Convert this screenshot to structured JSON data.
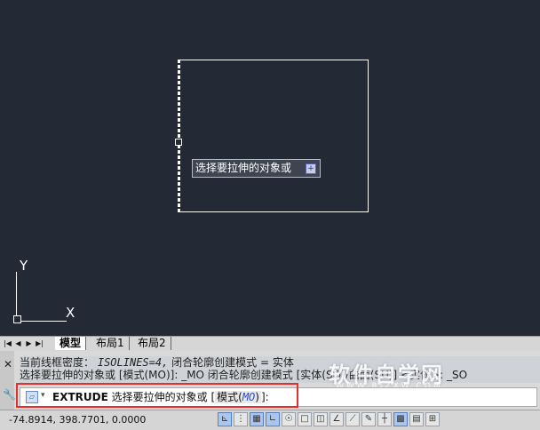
{
  "tooltip": {
    "text": "选择要拉伸的对象或",
    "expand_icon": "plus-box-icon",
    "expand_glyph": "+"
  },
  "ucs": {
    "y_label": "Y",
    "x_label": "X"
  },
  "layout_tabs": {
    "nav_glyphs": [
      "|◀",
      "◀",
      "▶",
      "▶|"
    ],
    "tabs": [
      {
        "label": "模型",
        "active": true
      },
      {
        "label": "布局1",
        "active": false
      },
      {
        "label": "布局2",
        "active": false
      }
    ]
  },
  "command_history": {
    "line1_prefix": "当前线框密度：",
    "line1_var": "ISOLINES=4,",
    "line1_suffix": "闭合轮廓创建模式 = 实体",
    "line2": "选择要拉伸的对象或 [模式(MO)]: _MO 闭合轮廓创建模式 [实体(SO)/曲面(SU)] <实体>: _SO"
  },
  "watermark": {
    "text": "软件自学网",
    "sub": "WWW.RJZXW.COM"
  },
  "command_line": {
    "icon": "extrude-command-icon",
    "command": "EXTRUDE",
    "prompt": "选择要拉伸的对象或",
    "open_bracket": "[",
    "option_label": "模式(",
    "option_key": "MO",
    "option_close": ")",
    "close_bracket": "]:"
  },
  "status_bar": {
    "coordinates": "-74.8914, 398.7701, 0.0000",
    "tools": [
      "infer-constraints",
      "snap-mode",
      "grid-display",
      "ortho-mode",
      "polar-tracking",
      "object-snap",
      "3d-object-snap",
      "object-snap-tracking",
      "dynamic-ucs",
      "dynamic-input",
      "lineweight",
      "transparency",
      "quick-properties",
      "selection-cycling"
    ]
  },
  "colors": {
    "canvas_bg": "#232a36",
    "highlight_box": "#e03030",
    "option_key": "#2a4bd6"
  }
}
